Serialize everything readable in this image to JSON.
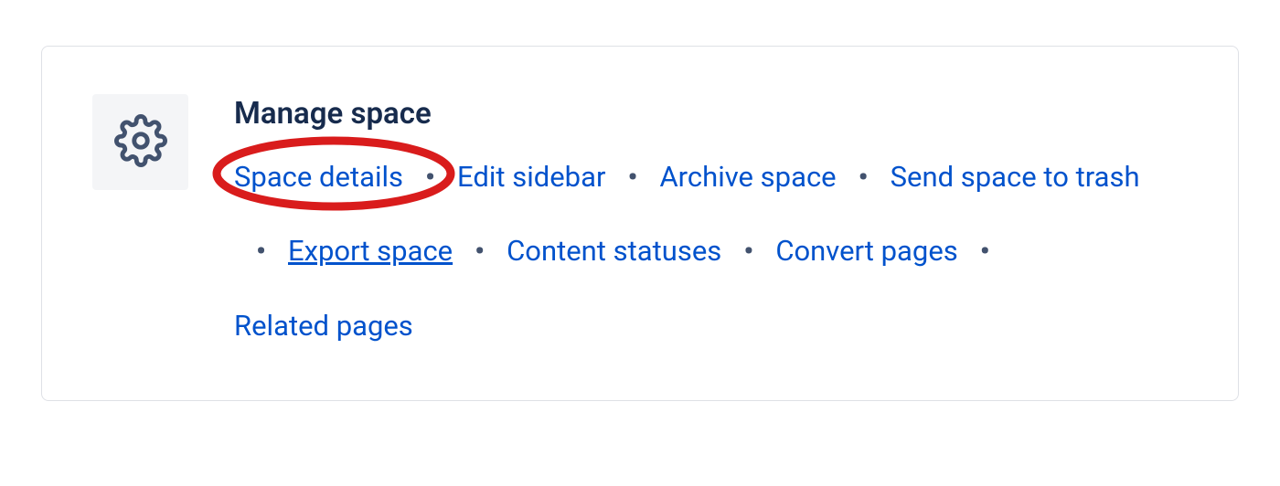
{
  "title": "Manage space",
  "icon": "gear",
  "links": [
    {
      "label": "Space details",
      "underlined": false,
      "highlighted": true
    },
    {
      "label": "Edit sidebar",
      "underlined": false,
      "highlighted": false
    },
    {
      "label": "Archive space",
      "underlined": false,
      "highlighted": false
    },
    {
      "label": "Send space to trash",
      "underlined": false,
      "highlighted": false
    },
    {
      "label": "Export space",
      "underlined": true,
      "highlighted": false
    },
    {
      "label": "Content statuses",
      "underlined": false,
      "highlighted": false
    },
    {
      "label": "Convert pages",
      "underlined": false,
      "highlighted": false
    },
    {
      "label": "Related pages",
      "underlined": false,
      "highlighted": false
    }
  ],
  "separator": "•",
  "colors": {
    "link": "#0052cc",
    "text": "#172b4d",
    "highlight": "#d91c1c",
    "iconBg": "#f4f5f7",
    "border": "#dfe1e6"
  },
  "separatorsAfter": [
    0,
    1,
    2,
    3,
    4,
    5,
    6
  ]
}
